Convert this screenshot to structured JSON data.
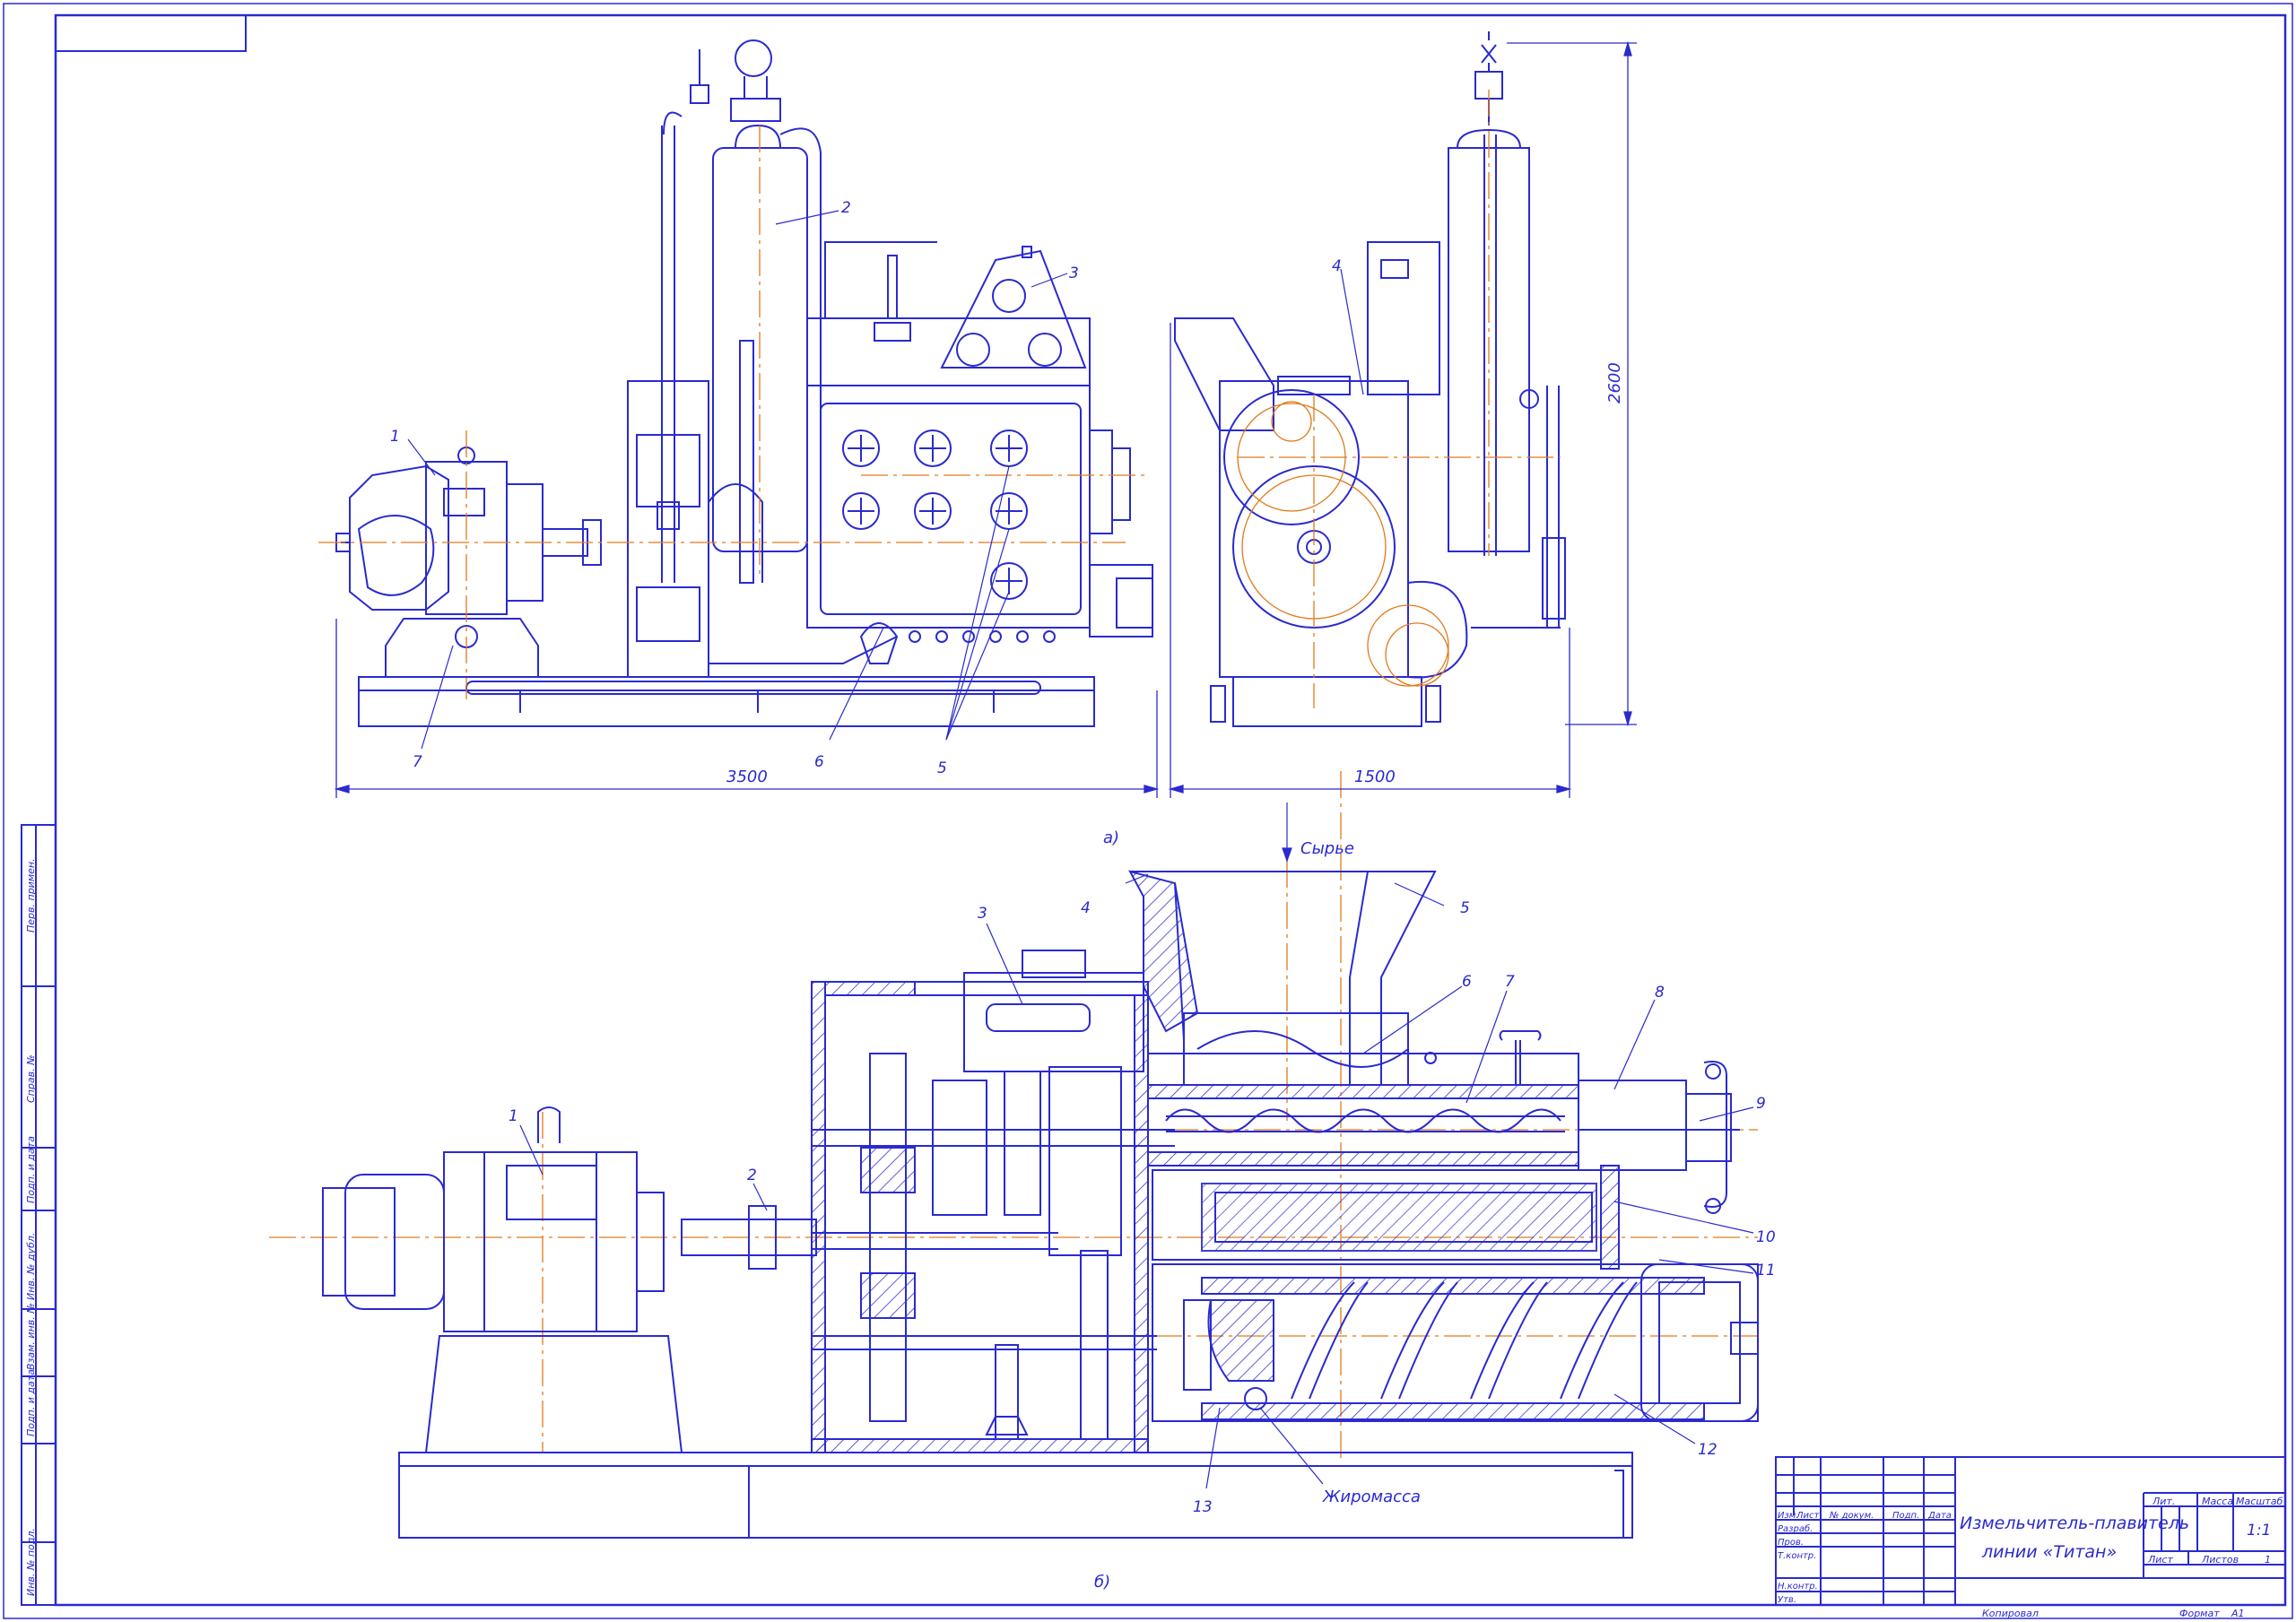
{
  "drawing": {
    "title_line1": "Измельчитель-плавитель",
    "title_line2": "линии «Титан»",
    "view_a_caption": "а)",
    "view_b_caption": "б)",
    "raw_material_label": "Сырье",
    "fat_mass_label": "Жиромасса"
  },
  "dimensions": {
    "width_front": "3500",
    "width_side": "1500",
    "height_side": "2600"
  },
  "callouts_a": {
    "c1": "1",
    "c2": "2",
    "c3": "3",
    "c4": "4",
    "c5": "5",
    "c6": "6",
    "c7": "7"
  },
  "callouts_b": {
    "c1": "1",
    "c2": "2",
    "c3": "3",
    "c4": "4",
    "c5": "5",
    "c6": "6",
    "c7": "7",
    "c8": "8",
    "c9": "9",
    "c10": "10",
    "c11": "11",
    "c12": "12",
    "c13": "13"
  },
  "side_strip": {
    "s1": "Перв. примен.",
    "s2": "Справ. №",
    "s3": "Подп. и дата",
    "s4": "Инв. № дубл.",
    "s5": "Взам. инв. №",
    "s6": "Подп. и дата",
    "s7": "Инв. № подл."
  },
  "title_block": {
    "h_izm": "Изм.",
    "h_list": "Лист",
    "h_doc": "№ докум.",
    "h_podp": "Подп.",
    "h_data": "Дата",
    "r_razrab": "Разраб.",
    "r_prov": "Пров.",
    "r_tkontr": "Т.контр.",
    "r_nkontr": "Н.контр.",
    "r_utv": "Утв.",
    "lit": "Лит.",
    "massa": "Масса",
    "masshtab": "Масштаб",
    "scale_value": "1:1",
    "list_label": "Лист",
    "listov_label": "Листов",
    "listov_value": "1",
    "kopiroval": "Копировал",
    "format_label": "Формат",
    "format_value": "А1"
  }
}
